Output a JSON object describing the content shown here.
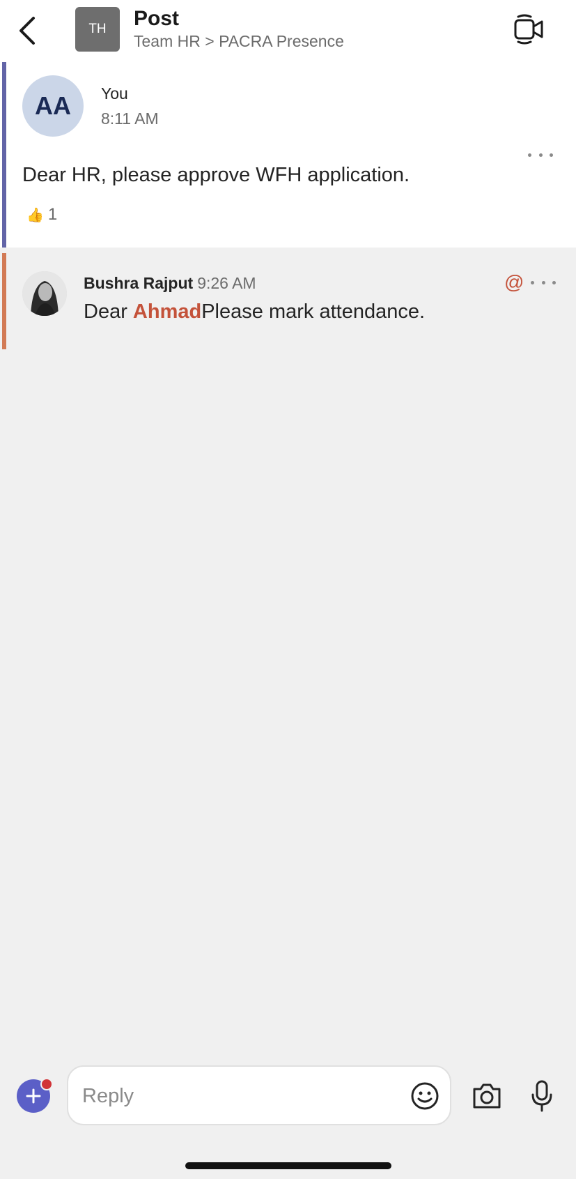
{
  "header": {
    "team_initials": "TH",
    "title": "Post",
    "breadcrumb": "Team HR > PACRA Presence"
  },
  "post": {
    "avatar_initials": "AA",
    "author": "You",
    "time": "8:11 AM",
    "body": "Dear HR, please approve WFH application.",
    "reaction_emoji": "👍",
    "reaction_count": "1"
  },
  "reply": {
    "author": "Bushra Rajput",
    "time": "9:26 AM",
    "mention_symbol": "@",
    "body_prefix": "Dear ",
    "mention_name": "Ahmad",
    "body_suffix": "Please mark attendance."
  },
  "composer": {
    "placeholder": "Reply"
  },
  "colors": {
    "post_accent": "#6264a7",
    "reply_accent": "#d27a55",
    "mention": "#c4523a",
    "brand": "#5b5fc7"
  },
  "icons": [
    "back-arrow-icon",
    "video-call-icon",
    "more-options-icon",
    "at-mention-icon",
    "plus-icon",
    "emoji-icon",
    "camera-icon",
    "microphone-icon"
  ]
}
